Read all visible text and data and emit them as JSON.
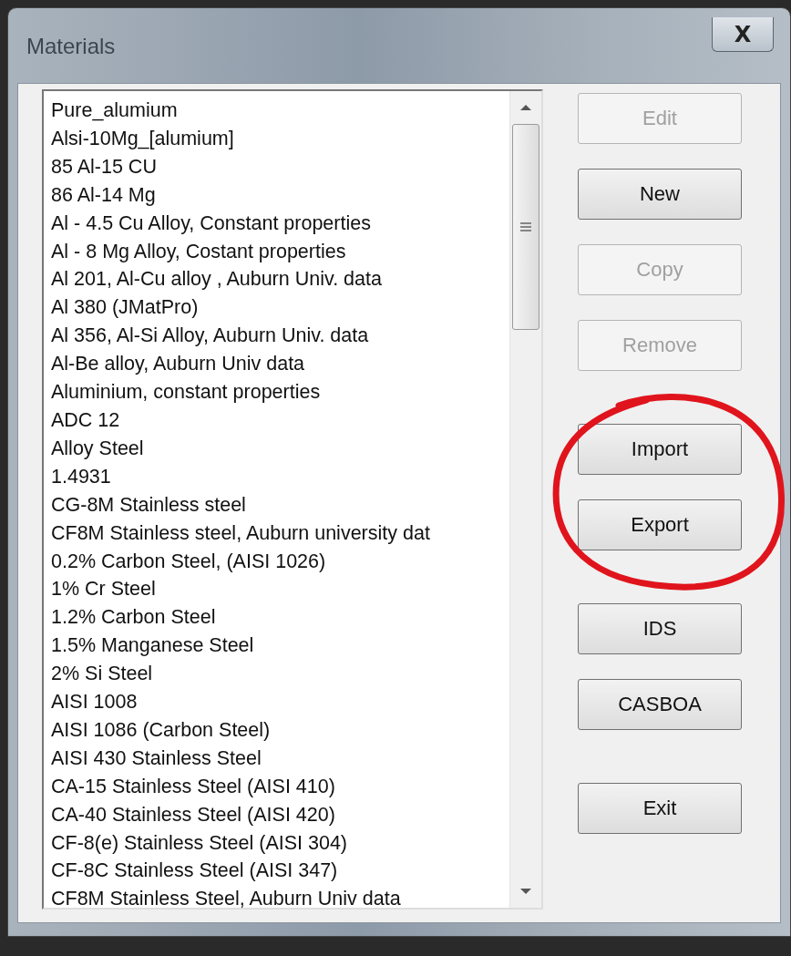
{
  "window": {
    "title": "Materials",
    "close": "X"
  },
  "materials": [
    {
      "name": "Pure_alumium",
      "selected": false
    },
    {
      "name": "Alsi-10Mg_[alumium]",
      "selected": false
    },
    {
      "name": "85 Al-15 CU",
      "selected": false
    },
    {
      "name": "86 Al-14 Mg",
      "selected": false
    },
    {
      "name": "Al - 4.5 Cu Alloy, Constant properties",
      "selected": false
    },
    {
      "name": "Al - 8 Mg Alloy, Costant properties",
      "selected": false
    },
    {
      "name": "Al 201, Al-Cu alloy , Auburn Univ. data",
      "selected": false
    },
    {
      "name": "Al 380 (JMatPro)",
      "selected": false
    },
    {
      "name": "Al 356, Al-Si Alloy, Auburn Univ. data",
      "selected": false
    },
    {
      "name": "Al-Be alloy, Auburn Univ data",
      "selected": false
    },
    {
      "name": "Aluminium, constant properties",
      "selected": false
    },
    {
      "name": "ADC 12",
      "selected": false
    },
    {
      "name": "Alloy Steel",
      "selected": false
    },
    {
      "name": "1.4931",
      "selected": false
    },
    {
      "name": "CG-8M Stainless steel",
      "selected": false
    },
    {
      "name": "CF8M Stainless steel, Auburn university dat",
      "selected": false
    },
    {
      "name": "0.2% Carbon Steel, (AISI 1026)",
      "selected": false
    },
    {
      "name": "1% Cr Steel",
      "selected": false
    },
    {
      "name": "1.2% Carbon Steel",
      "selected": false
    },
    {
      "name": "1.5% Manganese Steel",
      "selected": false
    },
    {
      "name": "2% Si Steel",
      "selected": false
    },
    {
      "name": "AISI 1008",
      "selected": false
    },
    {
      "name": "AISI 1086 (Carbon Steel)",
      "selected": false
    },
    {
      "name": "AISI 430 Stainless Steel",
      "selected": false
    },
    {
      "name": "CA-15 Stainless Steel (AISI 410)",
      "selected": false
    },
    {
      "name": "CA-40 Stainless Steel (AISI 420)",
      "selected": false
    },
    {
      "name": "CF-8(e) Stainless Steel (AISI 304)",
      "selected": false
    },
    {
      "name": "CF-8C Stainless Steel (AISI 347)",
      "selected": false
    },
    {
      "name": "CF8M Stainless Steel, Auburn Univ data",
      "selected": false
    }
  ],
  "button_groups": [
    [
      {
        "label": "Edit",
        "disabled": true
      },
      {
        "label": "New",
        "disabled": false
      },
      {
        "label": "Copy",
        "disabled": true
      },
      {
        "label": "Remove",
        "disabled": true
      }
    ],
    [
      {
        "label": "Import",
        "disabled": false
      },
      {
        "label": "Export",
        "disabled": false
      }
    ],
    [
      {
        "label": "IDS",
        "disabled": false
      },
      {
        "label": "CASBOA",
        "disabled": false
      }
    ],
    [
      {
        "label": "Exit",
        "disabled": false
      }
    ]
  ]
}
